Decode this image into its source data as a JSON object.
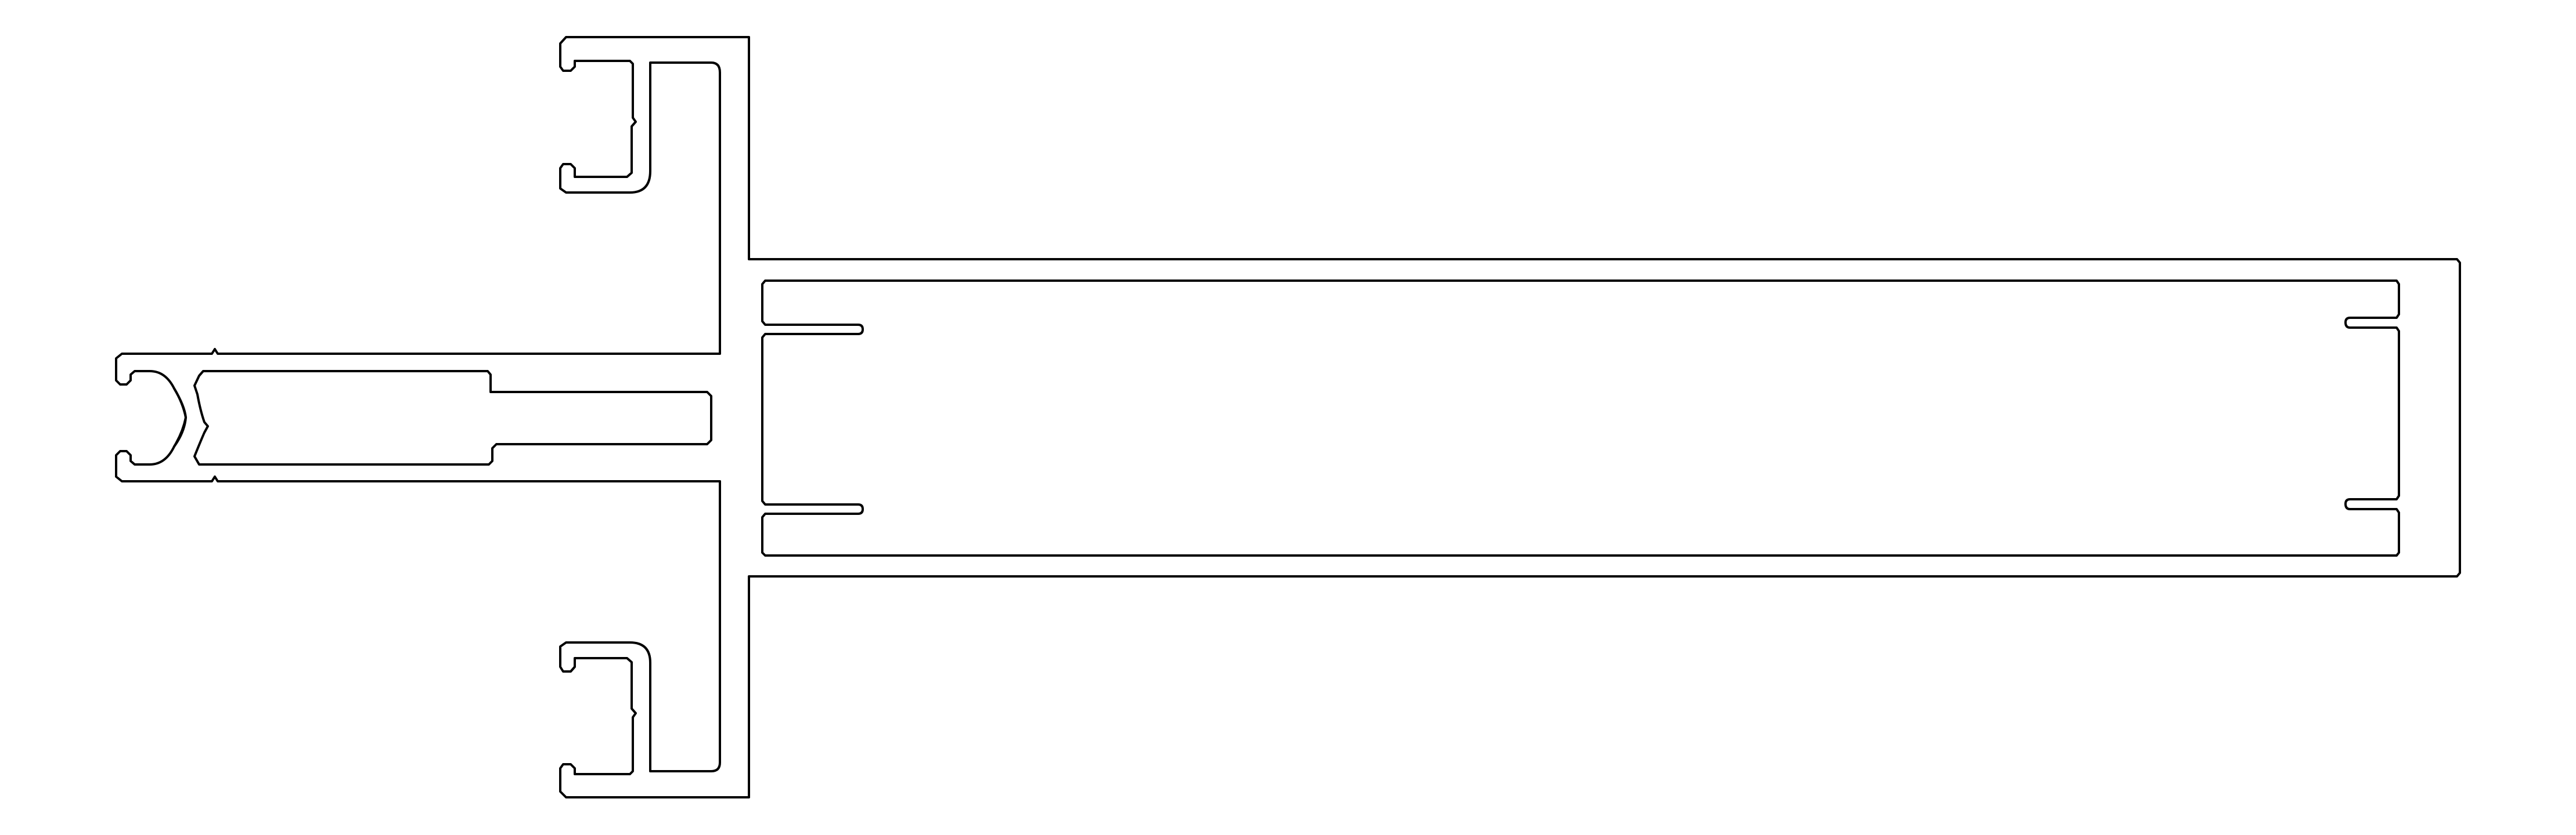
{
  "diagram": {
    "kind": "aluminium extrusion profile cross-section",
    "style": {
      "background": "#ffffff",
      "line_color": "#000000"
    },
    "parts": [
      "outer-outline",
      "main-chamber",
      "upper-clip-channel",
      "lower-clip-channel",
      "left-rod-slot",
      "left-glazing-insert"
    ]
  }
}
